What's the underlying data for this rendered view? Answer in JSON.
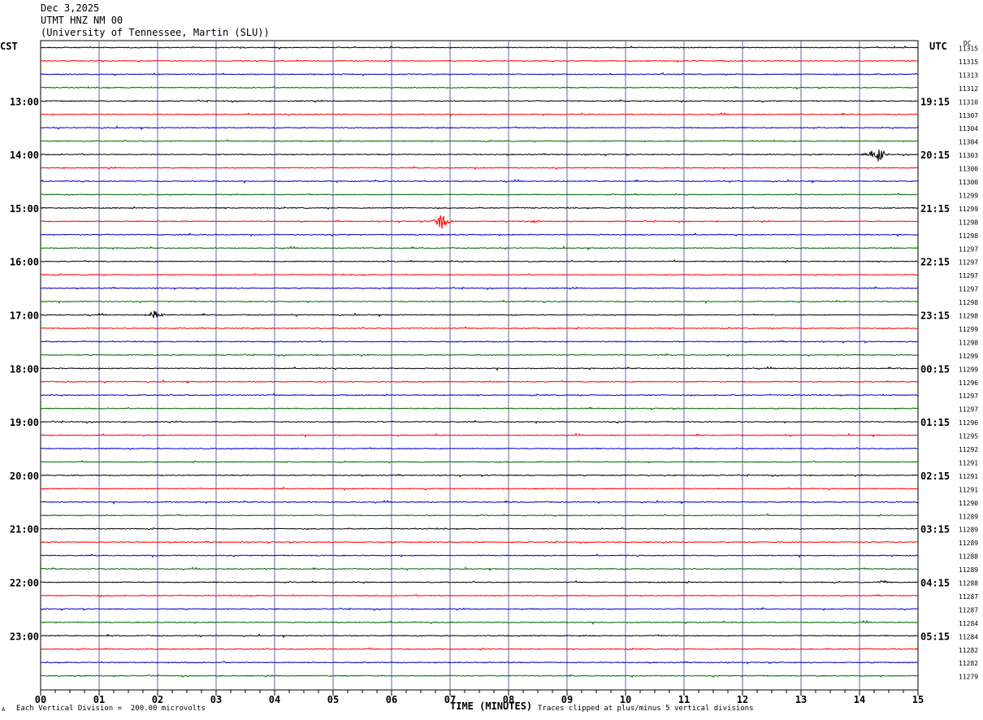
{
  "header": {
    "date": "Dec 3,2025",
    "station": "UTMT HNZ NM 00",
    "network": "(University of Tennessee, Martin (SLU))"
  },
  "left_tz": "CST",
  "right_tz": "UTC",
  "dc_label": "DC",
  "footer": {
    "left_mark": "A",
    "scale_note": "Each Vertical Division =  200.00 microvolts",
    "xlabel": "TIME (MINUTES)",
    "clip_note": "Traces clipped at plus/minus 5 vertical divisions"
  },
  "colors": {
    "trace_cycle": [
      "#000000",
      "#ff0000",
      "#0000cc",
      "#006600"
    ],
    "grid_vertical": "#6666aa"
  },
  "chart_data": {
    "type": "line",
    "title": "UTMT HNZ NM 00",
    "xlabel": "TIME (MINUTES)",
    "xlim": [
      0,
      15
    ],
    "x_ticks": [
      "00",
      "01",
      "02",
      "03",
      "04",
      "05",
      "06",
      "07",
      "08",
      "09",
      "10",
      "11",
      "12",
      "13",
      "14",
      "15"
    ],
    "trace_count": 48,
    "trace_minutes": 15,
    "left_labels": [
      {
        "row": 4,
        "text": "13:00"
      },
      {
        "row": 8,
        "text": "14:00"
      },
      {
        "row": 12,
        "text": "15:00"
      },
      {
        "row": 16,
        "text": "16:00"
      },
      {
        "row": 20,
        "text": "17:00"
      },
      {
        "row": 24,
        "text": "18:00"
      },
      {
        "row": 28,
        "text": "19:00"
      },
      {
        "row": 32,
        "text": "20:00"
      },
      {
        "row": 36,
        "text": "21:00"
      },
      {
        "row": 40,
        "text": "22:00"
      },
      {
        "row": 44,
        "text": "23:00"
      }
    ],
    "right_labels": [
      {
        "row": 4,
        "text": "19:15"
      },
      {
        "row": 8,
        "text": "20:15"
      },
      {
        "row": 12,
        "text": "21:15"
      },
      {
        "row": 16,
        "text": "22:15"
      },
      {
        "row": 20,
        "text": "23:15"
      },
      {
        "row": 24,
        "text": "00:15"
      },
      {
        "row": 28,
        "text": "01:15"
      },
      {
        "row": 32,
        "text": "02:15"
      },
      {
        "row": 36,
        "text": "03:15"
      },
      {
        "row": 40,
        "text": "04:15"
      },
      {
        "row": 44,
        "text": "05:15"
      }
    ],
    "dc_values": [
      "11315",
      "11315",
      "11313",
      "11312",
      "11310",
      "11307",
      "11304",
      "11304",
      "11303",
      "11300",
      "11300",
      "11299",
      "11299",
      "11298",
      "11298",
      "11297",
      "11297",
      "11297",
      "11297",
      "11298",
      "11298",
      "11299",
      "11298",
      "11299",
      "11299",
      "11296",
      "11297",
      "11297",
      "11296",
      "11295",
      "11292",
      "11291",
      "11291",
      "11291",
      "11290",
      "11289",
      "11289",
      "11289",
      "11288",
      "11289",
      "11288",
      "11287",
      "11287",
      "11284",
      "11284",
      "11282",
      "11282",
      "11279"
    ],
    "events": [
      {
        "row": 8,
        "minute": 14.3,
        "amplitude_divisions": 1.0
      },
      {
        "row": 13,
        "minute": 6.85,
        "amplitude_divisions": 0.7
      },
      {
        "row": 13,
        "minute": 8.45,
        "amplitude_divisions": 0.15
      },
      {
        "row": 20,
        "minute": 1.95,
        "amplitude_divisions": 0.4
      },
      {
        "row": 40,
        "minute": 14.4,
        "amplitude_divisions": 0.15
      }
    ]
  }
}
